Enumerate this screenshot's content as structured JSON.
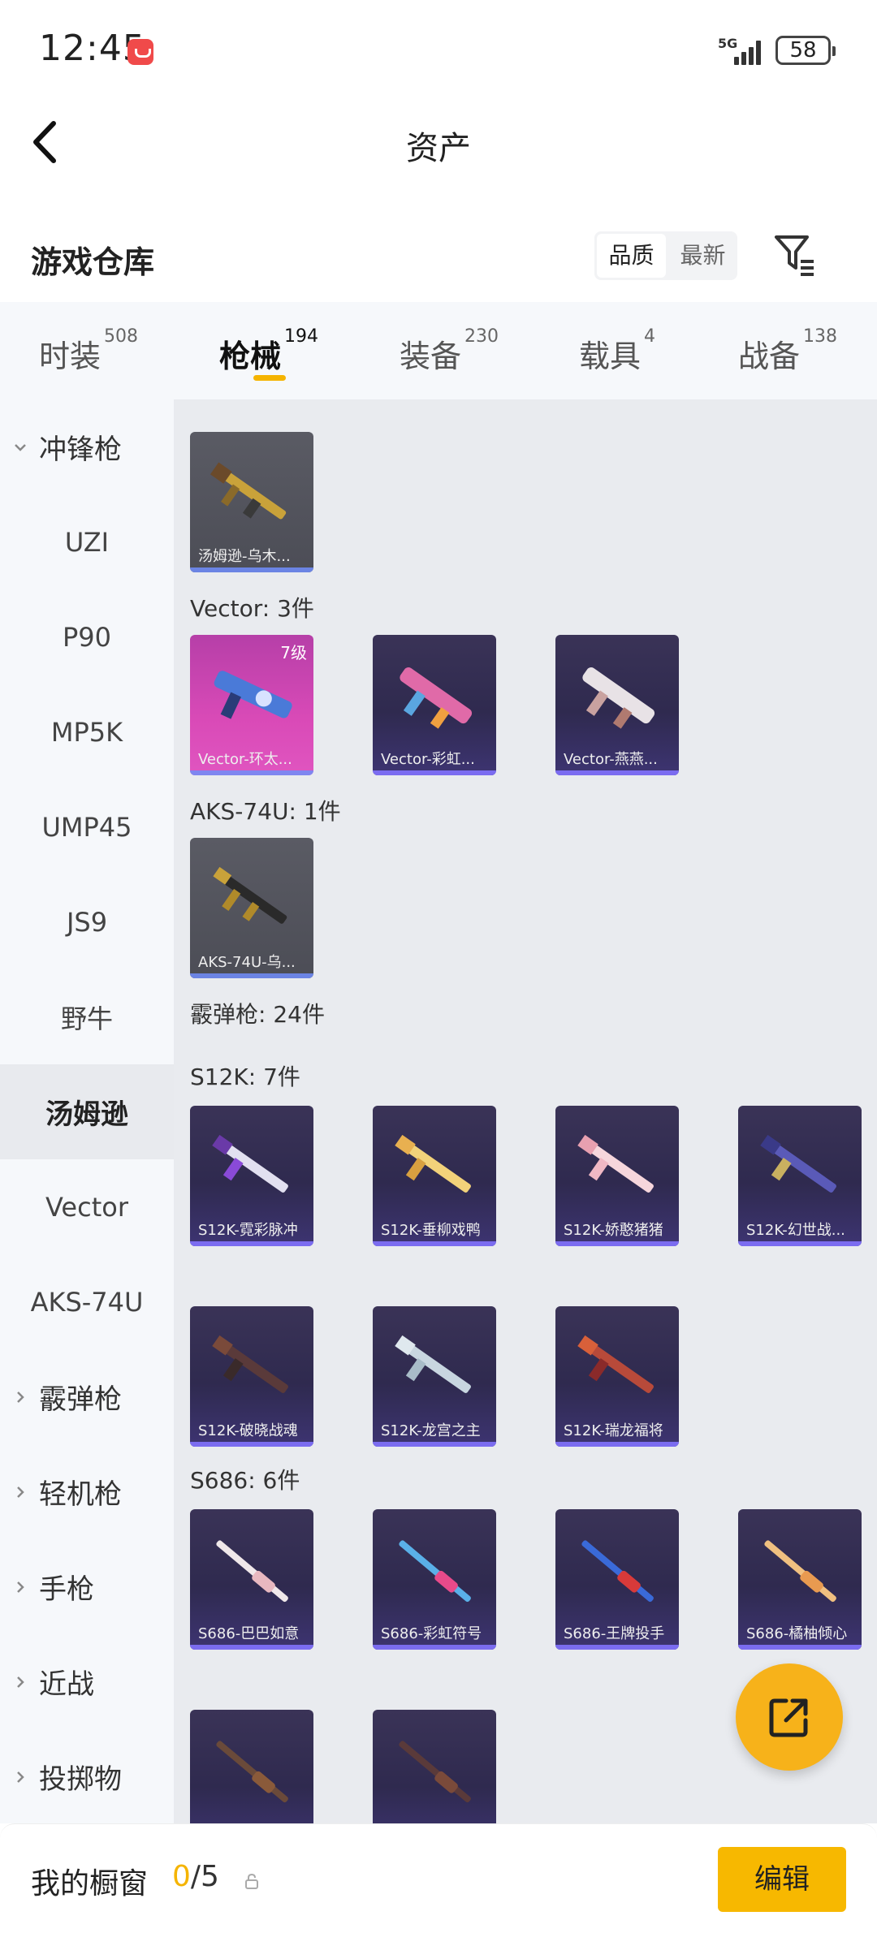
{
  "status": {
    "time": "12:45",
    "network": "5G",
    "battery": "58"
  },
  "header": {
    "title": "资产"
  },
  "warehouse": {
    "title": "游戏仓库",
    "sort_options": [
      "品质",
      "最新"
    ]
  },
  "tabs": [
    {
      "label": "时装",
      "count": "508"
    },
    {
      "label": "枪械",
      "count": "194"
    },
    {
      "label": "装备",
      "count": "230"
    },
    {
      "label": "载具",
      "count": "4"
    },
    {
      "label": "战备",
      "count": "138"
    }
  ],
  "sidebar": {
    "items": [
      "冲锋枪",
      "UZI",
      "P90",
      "MP5K",
      "UMP45",
      "JS9",
      "野牛",
      "汤姆逊",
      "Vector",
      "AKS-74U",
      "霰弹枪",
      "轻机枪",
      "手枪",
      "近战",
      "投掷物"
    ]
  },
  "content": {
    "groups": [
      {
        "label": "",
        "items": [
          {
            "name": "汤姆逊-乌木..."
          }
        ]
      },
      {
        "label": "Vector: 3件",
        "items": [
          {
            "name": "Vector-环太...",
            "level": "7级"
          },
          {
            "name": "Vector-彩虹..."
          },
          {
            "name": "Vector-燕燕..."
          }
        ]
      },
      {
        "label": "AKS-74U: 1件",
        "items": [
          {
            "name": "AKS-74U-乌..."
          }
        ]
      },
      {
        "label": "霰弹枪: 24件",
        "items": []
      },
      {
        "label": "S12K: 7件",
        "items": [
          {
            "name": "S12K-霓彩脉冲"
          },
          {
            "name": "S12K-垂柳戏鸭"
          },
          {
            "name": "S12K-娇憨猪猪"
          },
          {
            "name": "S12K-幻世战..."
          },
          {
            "name": "S12K-破晓战魂"
          },
          {
            "name": "S12K-龙宫之主"
          },
          {
            "name": "S12K-瑞龙福将"
          }
        ]
      },
      {
        "label": "S686: 6件",
        "items": [
          {
            "name": "S686-巴巴如意"
          },
          {
            "name": "S686-彩虹符号"
          },
          {
            "name": "S686-王牌投手"
          },
          {
            "name": "S686-橘柚倾心"
          },
          {
            "name": ""
          },
          {
            "name": ""
          }
        ]
      }
    ]
  },
  "bottom": {
    "window_label": "我的橱窗",
    "current": "0",
    "total": "/5",
    "edit_label": "编辑"
  },
  "colors": {
    "accent": "#f5b400",
    "card_purple": "#2f2a4f",
    "card_pink": "#d94ab7"
  }
}
